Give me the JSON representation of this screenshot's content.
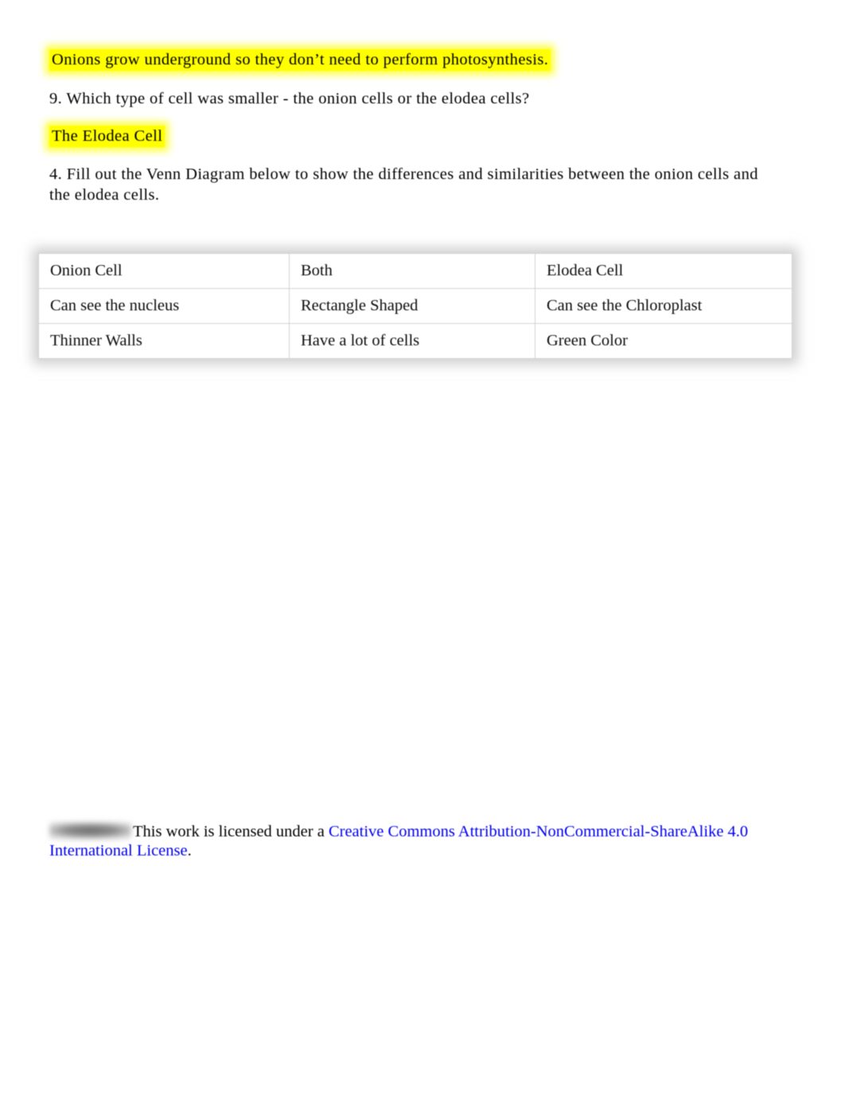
{
  "document": {
    "answer_photosynthesis": "Onions grow underground so they don’t need to perform photosynthesis.",
    "question_9": "9. Which type of cell was smaller - the onion cells or the elodea cells?",
    "answer_elodea": "The Elodea Cell",
    "question_4": "4. Fill out the Venn Diagram below to show the differences and similarities between the onion cells and the elodea cells."
  },
  "venn_table": {
    "rows": [
      [
        "Onion Cell",
        "Both",
        "Elodea Cell"
      ],
      [
        "Can see the nucleus",
        "Rectangle Shaped",
        "Can see the Chloroplast"
      ],
      [
        "Thinner Walls",
        "Have a lot of cells",
        "Green Color"
      ]
    ]
  },
  "footer": {
    "badge_alt": "creative-commons-license-badge",
    "lead_text": "This work is licensed under a ",
    "link_text": "Creative Commons Attribution-NonCommercial-ShareAlike 4.0 International License",
    "trailing_text": "."
  },
  "colors": {
    "highlight": "#ffff00",
    "link": "#0000ee",
    "text": "#000000",
    "table_border": "#d2d2d2",
    "page_background": "#ffffff"
  }
}
